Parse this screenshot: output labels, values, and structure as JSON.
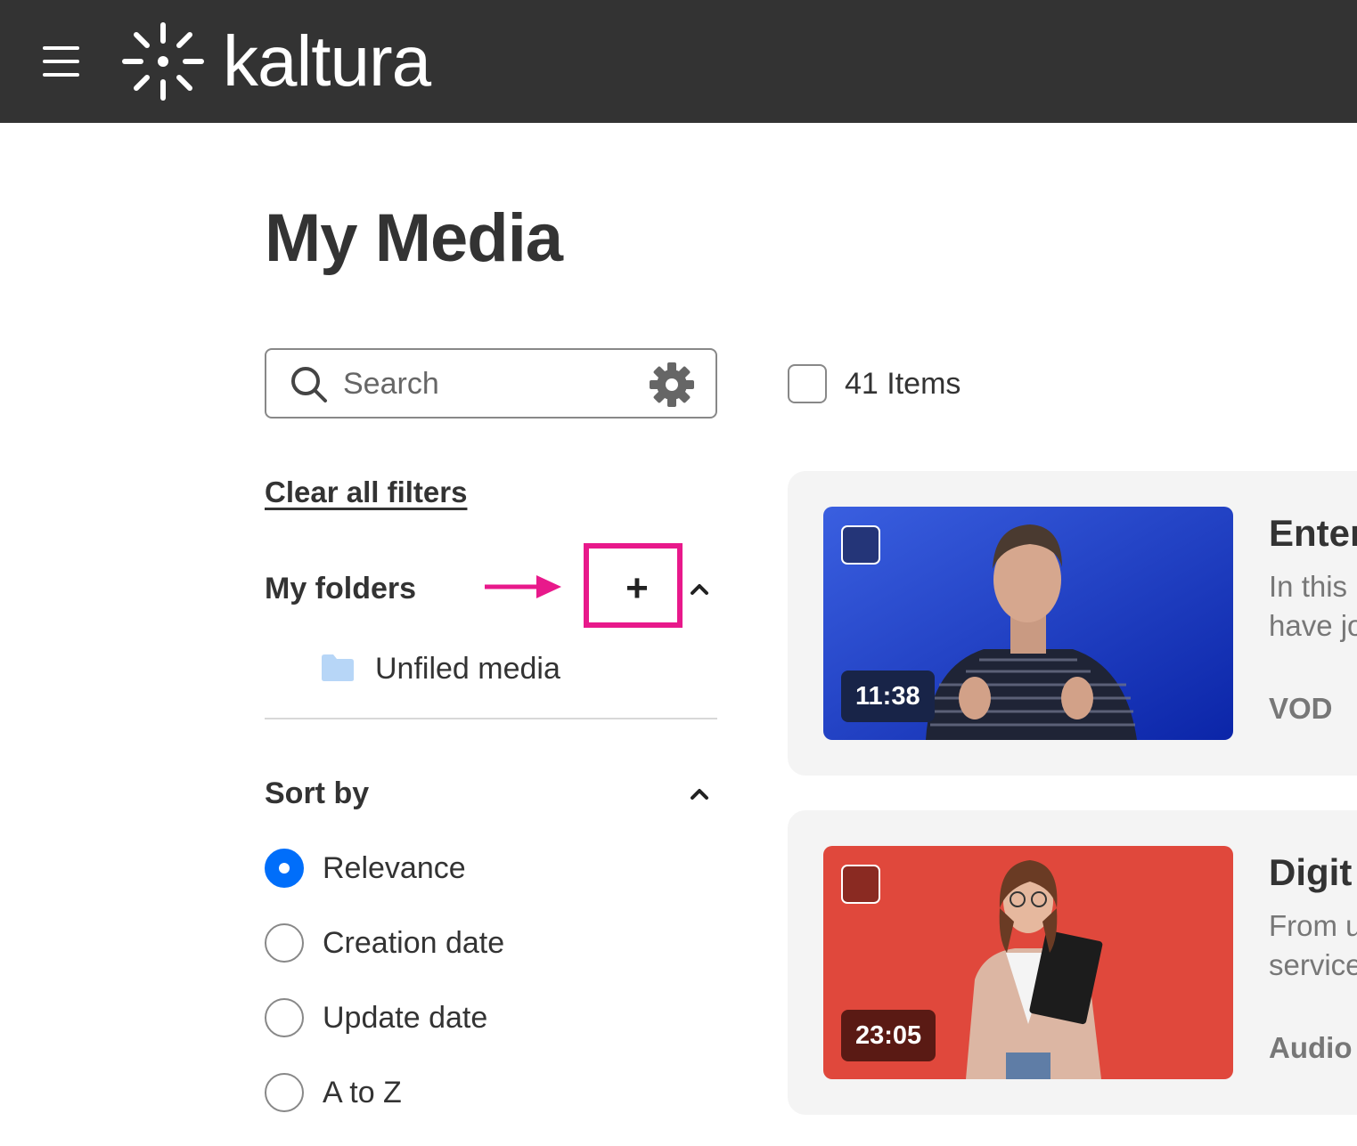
{
  "header": {
    "brand_name": "kaltura",
    "menu_icon": "hamburger-menu-icon",
    "logo_icon": "kaltura-logo-icon",
    "background": "#333333"
  },
  "page": {
    "title": "My Media"
  },
  "search": {
    "placeholder": "Search",
    "value": ""
  },
  "toolbar": {
    "items_count": "41 Items"
  },
  "filters": {
    "clear_all": "Clear all filters",
    "folders": {
      "heading": "My folders",
      "add_label": "+",
      "items": [
        {
          "label": "Unfiled media",
          "icon": "folder-icon"
        }
      ]
    },
    "sort": {
      "heading": "Sort by",
      "options": [
        {
          "label": "Relevance",
          "selected": true
        },
        {
          "label": "Creation date",
          "selected": false
        },
        {
          "label": "Update date",
          "selected": false
        },
        {
          "label": "A to Z",
          "selected": false
        }
      ]
    }
  },
  "media": [
    {
      "title": "Enter",
      "description": "In this\nhave jo",
      "type": "VOD",
      "duration": "11:38"
    },
    {
      "title": "Digit",
      "description": "From u\nservice",
      "type": "Audio",
      "duration": "23:05"
    }
  ],
  "colors": {
    "accent": "#006efa",
    "annotation": "#e8198b",
    "card_bg": "#f4f4f4",
    "thumb_blue": "#1f3fc2",
    "thumb_red": "#e0483c"
  }
}
